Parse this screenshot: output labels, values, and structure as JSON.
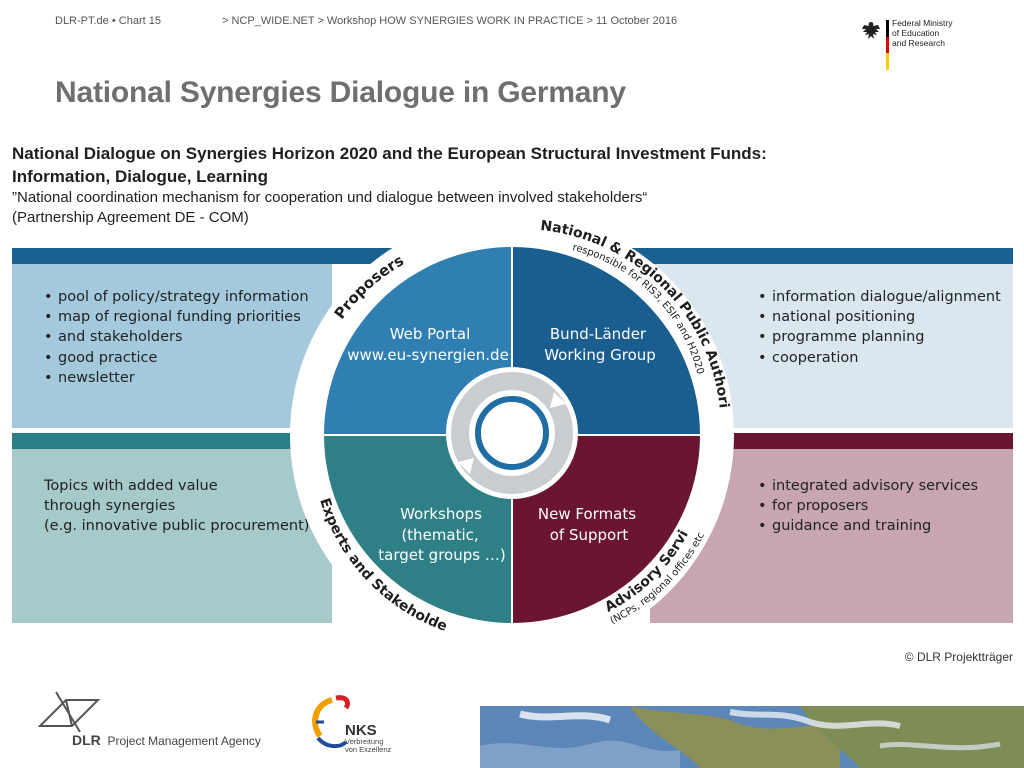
{
  "header": {
    "left": "DLR-PT.de  •  Chart 15",
    "breadcrumb": "> NCP_WIDE.NET > Workshop HOW SYNERGIES WORK IN PRACTICE > 11 October 2016",
    "ministry": [
      "Federal Ministry",
      "of Education",
      "and Research"
    ]
  },
  "title": "National Synergies Dialogue in Germany",
  "intro": {
    "line1": "National Dialogue on Synergies Horizon 2020 and the European Structural Investment Funds:",
    "line2": "Information, Dialogue, Learning",
    "line3": "”National coordination mechanism for cooperation und dialogue between involved stakeholders“",
    "line4": "(Partnership Agreement DE - COM)"
  },
  "left_top": [
    "pool of policy/strategy information",
    "map of regional funding  priorities",
    "good practice",
    "newsletter"
  ],
  "left_top_cont": "and stakeholders",
  "left_bottom": [
    "Topics with added value",
    "through synergies",
    "(e.g. innovative public procurement)"
  ],
  "right_top": [
    "information dialogue/alignment",
    "national positioning",
    "programme planning",
    "cooperation"
  ],
  "right_bottom": [
    "integrated advisory services",
    "guidance and training"
  ],
  "right_bottom_cont": "for proposers",
  "quadrants": {
    "tl": [
      "Web Portal",
      "www.eu-synergien.de"
    ],
    "tr": [
      "Bund-Länder",
      "Working Group"
    ],
    "bl": [
      "Workshops",
      "(thematic,",
      "target groups …)"
    ],
    "br": [
      "New Formats",
      "of Support"
    ]
  },
  "arc_labels": {
    "proposers": "Proposers",
    "authorities": "National & Regional Public Authorities",
    "authorities_sub": "responsible for RIS3, ESIF and H2020",
    "experts": "Experts and Stakeholders",
    "advisory": "Advisory Services",
    "advisory_sub": "(NCPs, regional offices etc.)"
  },
  "colors": {
    "blue_dark": "#1a6193",
    "blue_mid": "#2d7bb0",
    "teal": "#2a7f84",
    "wine": "#6b1630",
    "title_grey": "#6f6f6f"
  },
  "copyright": "© DLR Projektträger",
  "footer": {
    "dlr_short": "DLR",
    "dlr_label": "Project Management Agency",
    "nks": "NKS",
    "nks_sub": [
      "Verbreitung",
      "von Exzellenz"
    ],
    "icons": [
      "dlr-logo-icon",
      "nks-logo-icon",
      "earth-photo"
    ]
  }
}
